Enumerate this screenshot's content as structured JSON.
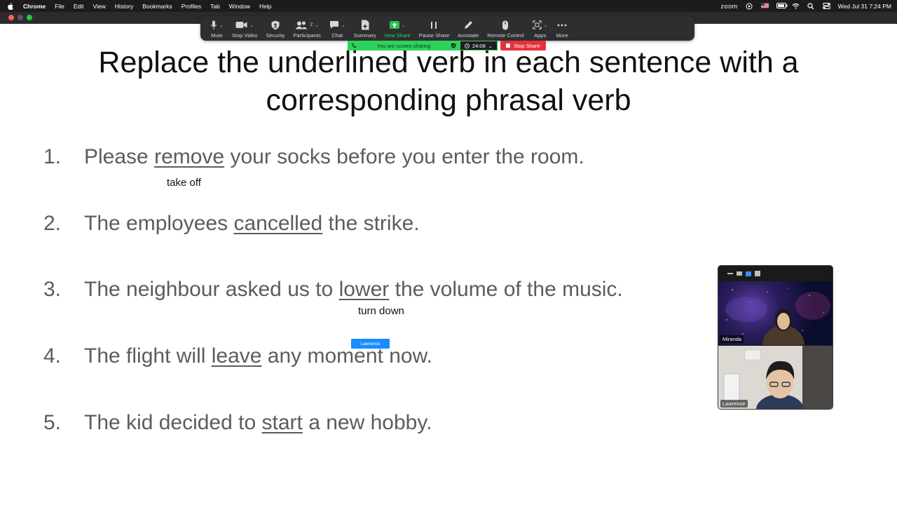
{
  "menubar": {
    "app": "Chrome",
    "items": [
      "File",
      "Edit",
      "View",
      "History",
      "Bookmarks",
      "Profiles",
      "Tab",
      "Window",
      "Help"
    ],
    "zoom_logo": "zoom",
    "datetime": "Wed Jul 31  7:24 PM"
  },
  "toolbar": {
    "items": [
      {
        "label": "Mute",
        "icon": "microphone-icon"
      },
      {
        "label": "Stop Video",
        "icon": "video-camera-icon"
      },
      {
        "label": "Security",
        "icon": "shield-icon"
      },
      {
        "label": "Participants",
        "icon": "participants-icon",
        "count": "2"
      },
      {
        "label": "Chat",
        "icon": "chat-bubble-icon"
      },
      {
        "label": "Summary",
        "icon": "summary-icon"
      },
      {
        "label": "New Share",
        "icon": "share-arrow-icon"
      },
      {
        "label": "Pause Share",
        "icon": "pause-icon"
      },
      {
        "label": "Annotate",
        "icon": "pencil-icon"
      },
      {
        "label": "Remote Control",
        "icon": "mouse-icon"
      },
      {
        "label": "Apps",
        "icon": "apps-icon"
      },
      {
        "label": "More",
        "icon": "more-dots-icon"
      }
    ],
    "accent_green": "#27d159"
  },
  "sharebar": {
    "status": "You are screen sharing",
    "timer": "24:08",
    "stop": "Stop Share",
    "stop_color": "#e8303a"
  },
  "slide": {
    "title": "Replace the underlined verb in each sentence with a corresponding phrasal verb",
    "questions": [
      {
        "num": "1.",
        "before": "Please ",
        "verb": "remove",
        "after": " your socks before you enter the room."
      },
      {
        "num": "2.",
        "before": "The employees ",
        "verb": "cancelled",
        "after": " the strike."
      },
      {
        "num": "3.",
        "before": "The neighbour asked us to ",
        "verb": "lower",
        "after": " the volume of the music."
      },
      {
        "num": "4.",
        "before": "The flight will ",
        "verb": "leave",
        "after": " any moment now."
      },
      {
        "num": "5.",
        "before": "The kid decided to ",
        "verb": "start",
        "after": " a new hobby."
      }
    ],
    "answers": [
      "take off",
      "turn down"
    ]
  },
  "cursor_tag": "Lawrence",
  "gallery": {
    "participants": [
      "Miranda",
      "Lawrence"
    ]
  }
}
